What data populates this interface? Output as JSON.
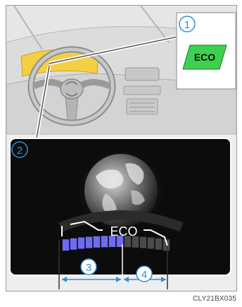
{
  "callouts": {
    "one": "1",
    "two": "2",
    "three": "3",
    "four": "4"
  },
  "indicator_label": "ECO",
  "display_label": "ECO",
  "figure_code": "CLY21BX035",
  "colors": {
    "indicator_bg": "#3fd04f",
    "highlight": "#f3cf44",
    "callout_blue": "#2f8fd6",
    "eco_zone": "#6f6cf2",
    "power_zone": "#4a4a4a"
  },
  "icons": [
    "steering-wheel-icon",
    "globe-icon",
    "eco-indicator-icon"
  ]
}
